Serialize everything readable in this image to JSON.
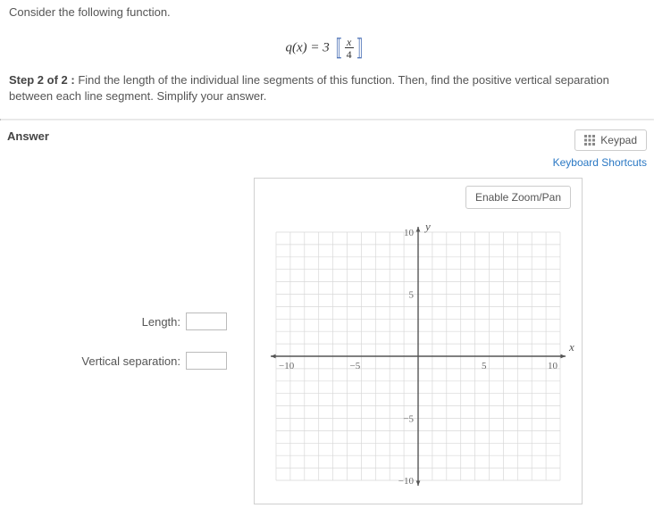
{
  "question": {
    "prompt": "Consider the following function.",
    "formula_lhs": "q(x) = 3",
    "formula_frac_num": "x",
    "formula_frac_den": "4",
    "step_label": "Step 2 of 2 :",
    "step_text": "Find the length of the individual line segments of this function. Then, find the positive vertical separation between each line segment. Simplify your answer."
  },
  "answer": {
    "heading": "Answer",
    "keypad_label": "Keypad",
    "shortcuts_label": "Keyboard Shortcuts",
    "length_label": "Length:",
    "length_value": "",
    "vsep_label": "Vertical separation:",
    "vsep_value": "",
    "zoom_label": "Enable Zoom/Pan"
  },
  "chart_data": {
    "type": "scatter",
    "title": "",
    "xlabel": "x",
    "ylabel": "y",
    "xlim": [
      -10,
      10
    ],
    "ylim": [
      -10,
      10
    ],
    "xticks": [
      -10,
      -5,
      5,
      10
    ],
    "yticks": [
      -10,
      -5,
      5,
      10
    ],
    "grid": true,
    "series": []
  }
}
